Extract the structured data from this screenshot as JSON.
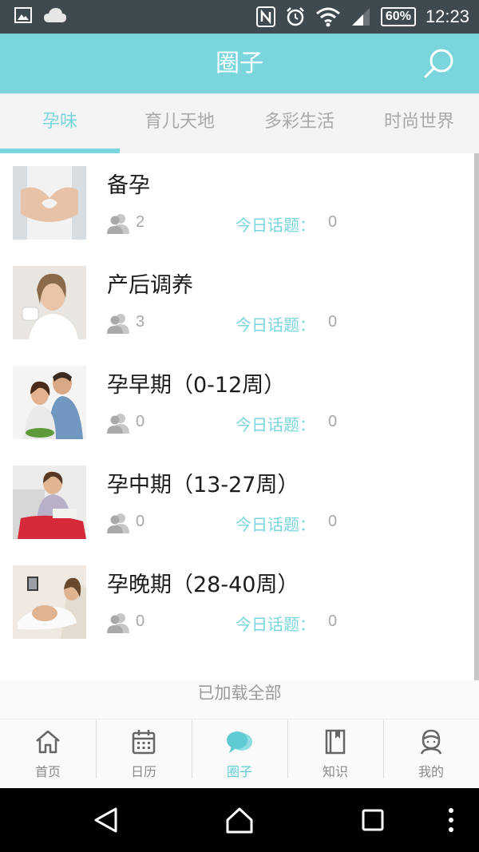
{
  "status_bar": {
    "time": "12:23",
    "battery": "60%",
    "icons": [
      "image-icon",
      "cloud-icon",
      "nfc-icon",
      "alarm-icon",
      "wifi-icon",
      "signal-icon",
      "battery-icon"
    ]
  },
  "header": {
    "title": "圈子",
    "search_icon": "search-icon"
  },
  "tabs": [
    {
      "label": "孕味",
      "active": true
    },
    {
      "label": "育儿天地",
      "active": false
    },
    {
      "label": "多彩生活",
      "active": false
    },
    {
      "label": "时尚世界",
      "active": false
    }
  ],
  "circles": [
    {
      "name": "备孕",
      "members": "2",
      "topic_label": "今日话题：",
      "topic_count": "0"
    },
    {
      "name": "产后调养",
      "members": "3",
      "topic_label": "今日话题：",
      "topic_count": "0"
    },
    {
      "name": "孕早期（0-12周）",
      "members": "0",
      "topic_label": "今日话题：",
      "topic_count": "0"
    },
    {
      "name": "孕中期（13-27周）",
      "members": "0",
      "topic_label": "今日话题：",
      "topic_count": "0"
    },
    {
      "name": "孕晚期（28-40周）",
      "members": "0",
      "topic_label": "今日话题：",
      "topic_count": "0"
    }
  ],
  "load_status": "已加载全部",
  "bottom_nav": [
    {
      "label": "首页",
      "icon": "home-icon",
      "active": false
    },
    {
      "label": "日历",
      "icon": "calendar-icon",
      "active": false
    },
    {
      "label": "圈子",
      "icon": "chat-bubbles-icon",
      "active": true
    },
    {
      "label": "知识",
      "icon": "book-icon",
      "active": false
    },
    {
      "label": "我的",
      "icon": "profile-icon",
      "active": false
    }
  ],
  "colors": {
    "accent": "#7ad6dc",
    "status_bar": "#3e4a4f",
    "muted_text": "#a9a9a9"
  }
}
